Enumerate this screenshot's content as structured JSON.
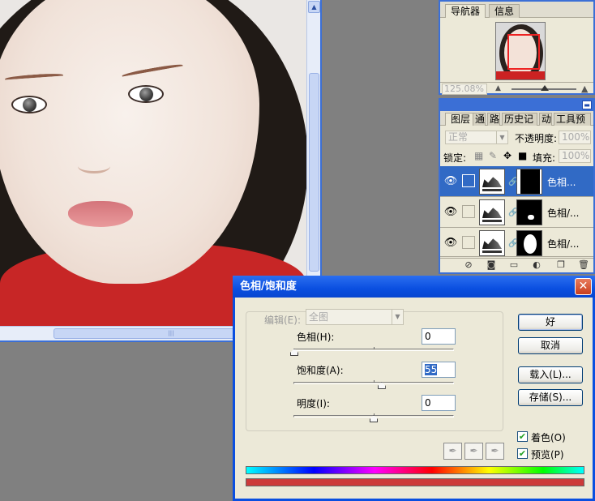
{
  "navigator": {
    "tabs": [
      "导航器",
      "信息"
    ],
    "zoom": "125.08%"
  },
  "layers": {
    "tabs": [
      "图层",
      "通道",
      "路径",
      "历史记录",
      "动作",
      "工具预设"
    ],
    "blend_mode": "正常",
    "opacity_label": "不透明度:",
    "opacity_value": "100%",
    "lock_label": "锁定:",
    "fill_label": "填充:",
    "fill_value": "100%",
    "rows": [
      {
        "name": "色相...",
        "selected": true
      },
      {
        "name": "色相/...",
        "selected": false
      },
      {
        "name": "色相/...",
        "selected": false
      }
    ]
  },
  "dialog": {
    "title": "色相/饱和度",
    "edit_label": "编辑(E):",
    "edit_value": "全图",
    "hue_label": "色相(H):",
    "hue_value": "0",
    "saturation_label": "饱和度(A):",
    "saturation_value": "55",
    "lightness_label": "明度(I):",
    "lightness_value": "0",
    "sliders": {
      "hue": 0,
      "saturation": 55,
      "lightness": 0
    },
    "buttons": {
      "ok": "好",
      "cancel": "取消",
      "load": "载入(L)...",
      "save": "存储(S)..."
    },
    "colorize_label": "着色(O)",
    "colorize_checked": true,
    "preview_label": "预览(P)",
    "preview_checked": true,
    "icons": [
      "eyedropper-icon",
      "eyedropper-plus-icon",
      "eyedropper-minus-icon"
    ]
  },
  "colors": {
    "accent": "#0a4fe0",
    "selection": "#316ac5",
    "colorized_bar": "#cc3a3a"
  }
}
